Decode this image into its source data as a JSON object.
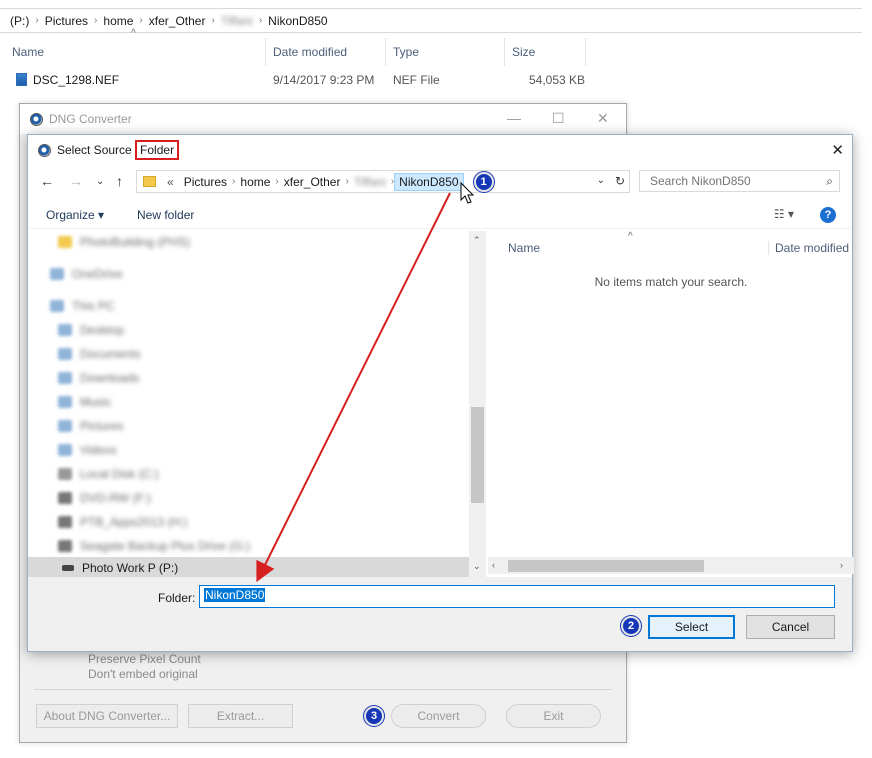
{
  "explorer": {
    "breadcrumbs": [
      "(P:)",
      "Pictures",
      "home",
      "xfer_Other",
      "Tiffani",
      "NikonD850"
    ],
    "columns": [
      "Name",
      "Date modified",
      "Type",
      "Size"
    ],
    "file": {
      "name": "DSC_1298.NEF",
      "date": "9/14/2017 9:23 PM",
      "type": "NEF File",
      "size": "54,053 KB"
    }
  },
  "dng_window": {
    "title": "DNG Converter",
    "options": [
      "Preserve Pixel Count",
      "Don't embed original"
    ],
    "buttons": {
      "about": "About DNG Converter...",
      "extract": "Extract...",
      "convert": "Convert",
      "exit": "Exit"
    }
  },
  "dialog": {
    "title_prefix": "Select Source ",
    "title_highlight": "Folder",
    "close": "✕",
    "address": {
      "overflow": "«",
      "crumbs": [
        "Pictures",
        "home",
        "xfer_Other",
        "Tiffani"
      ],
      "current": "NikonD850"
    },
    "search_placeholder": "Search NikonD850",
    "organize": "Organize ▾",
    "new_folder": "New folder",
    "help": "?",
    "tree": [
      "PhotoBuilding (PHS)",
      "OneDrive",
      "This PC",
      "Desktop",
      "Documents",
      "Downloads",
      "Music",
      "Pictures",
      "Videos",
      "Local Disk (C:)",
      "DVD-RW (F:)",
      "PTB_Apps2013 (H:)",
      "Seagate Backup Plus Drive (G:)"
    ],
    "tree_current": "Photo Work P (P:)",
    "columns": [
      "Name",
      "Date modified"
    ],
    "empty_message": "No items match your search.",
    "folder_label": "Folder:",
    "folder_value": "NikonD850",
    "select": "Select",
    "cancel": "Cancel"
  },
  "badges": [
    "1",
    "2",
    "3"
  ],
  "colors": {
    "annotation_red": "#d61f1f",
    "badge_blue": "#1637b8",
    "accent": "#0078d7"
  }
}
